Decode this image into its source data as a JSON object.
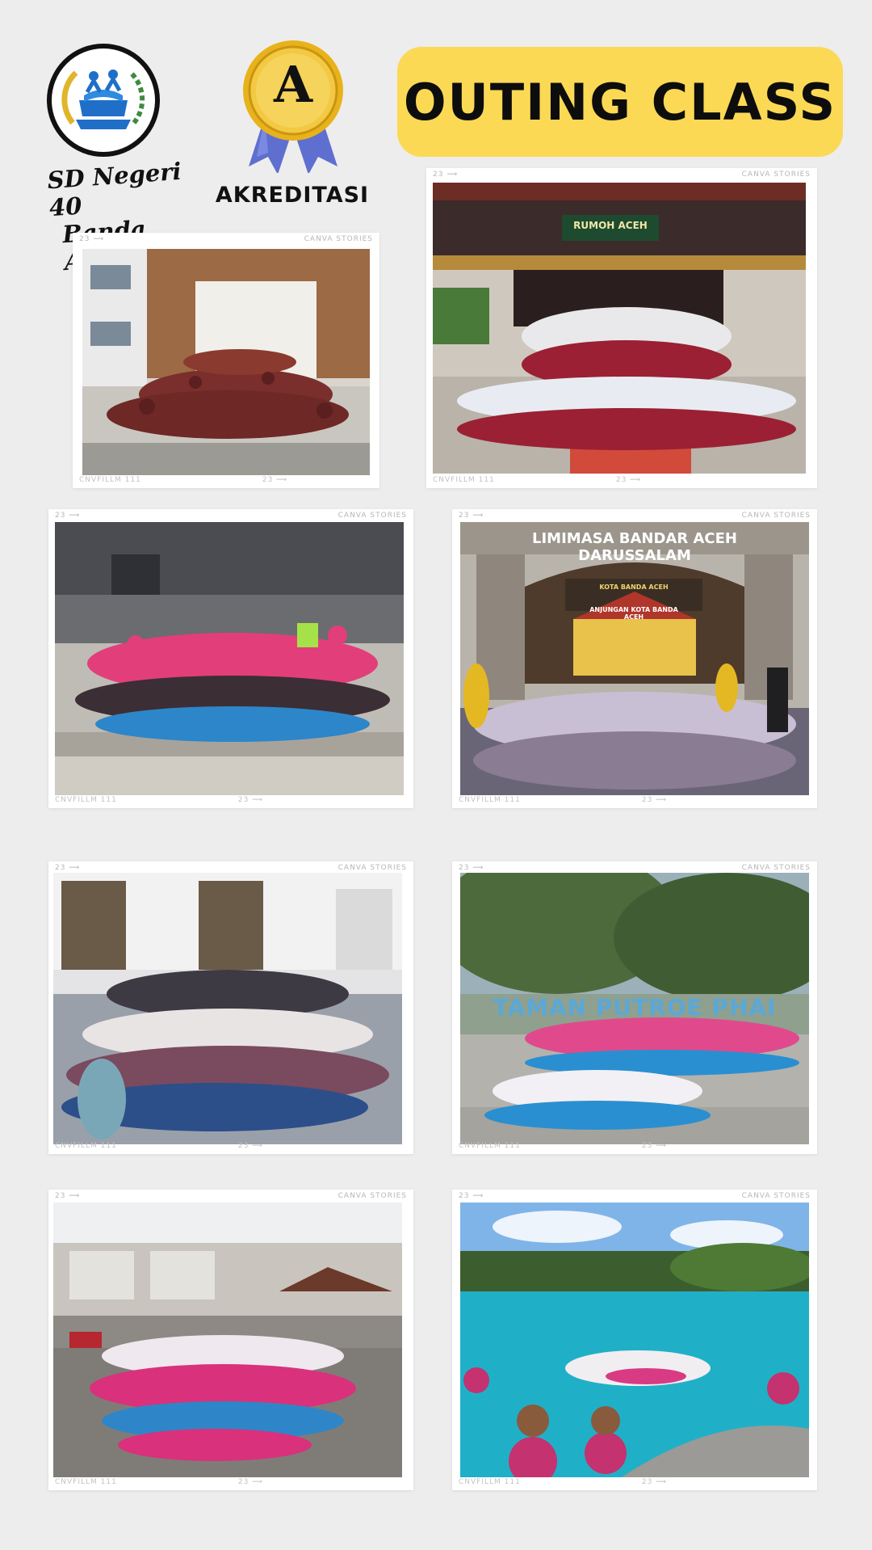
{
  "header": {
    "school_name_line1": "SD Negeri 40",
    "school_name_line2": "Banda Aceh",
    "accreditation_grade": "A",
    "accreditation_label": "AKREDITASI",
    "title": "OUTING CLASS"
  },
  "card_meta": {
    "top_left": "23 ⟿",
    "top_right": "CANVA STORIES",
    "bottom_left": "CNVFILLM 111",
    "bottom_right": "23 ⟿"
  },
  "photos": {
    "rumoh_aceh_sign": "RUMOH ACEH",
    "limimasa_sign": "LIMIMASA BANDAR ACEH DARUSSALAM",
    "kota_sign": "KOTA BANDA ACEH",
    "anjungan_sign": "ANJUNGAN KOTA BANDA ACEH",
    "taman_sign": "TAMAN PUTROE PHAI"
  },
  "colors": {
    "banner": "#fbd955",
    "background": "#ededed",
    "medal_gold": "#e8b21a",
    "ribbon": "#5e6fd0"
  }
}
